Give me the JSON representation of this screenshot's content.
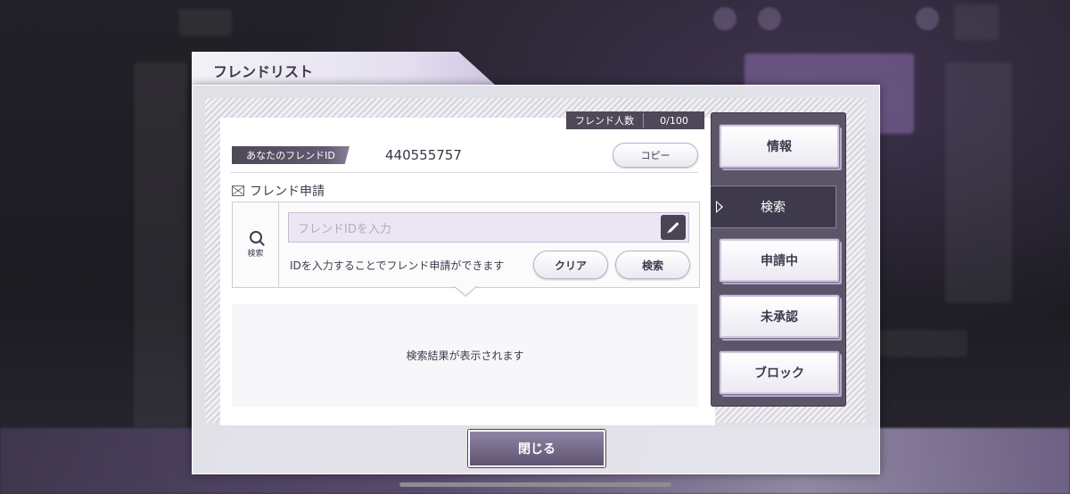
{
  "dialog": {
    "title": "フレンドリスト",
    "friend_count_label": "フレンド人数",
    "friend_count_value": "0/100",
    "your_id_label": "あなたのフレンドID",
    "your_id_value": "440555757",
    "copy_button": "コピー",
    "request_title": "フレンド申請",
    "search_side_label": "検索",
    "input_placeholder": "フレンドIDを入力",
    "hint_text": "IDを入力することでフレンド申請ができます",
    "clear_button": "クリア",
    "search_button": "検索",
    "results_placeholder": "検索結果が表示されます",
    "close_button": "閉じる"
  },
  "sidebar": {
    "items": [
      {
        "label": "情報"
      },
      {
        "label": "検索"
      },
      {
        "label": "申請中"
      },
      {
        "label": "未承認"
      },
      {
        "label": "ブロック"
      }
    ]
  }
}
